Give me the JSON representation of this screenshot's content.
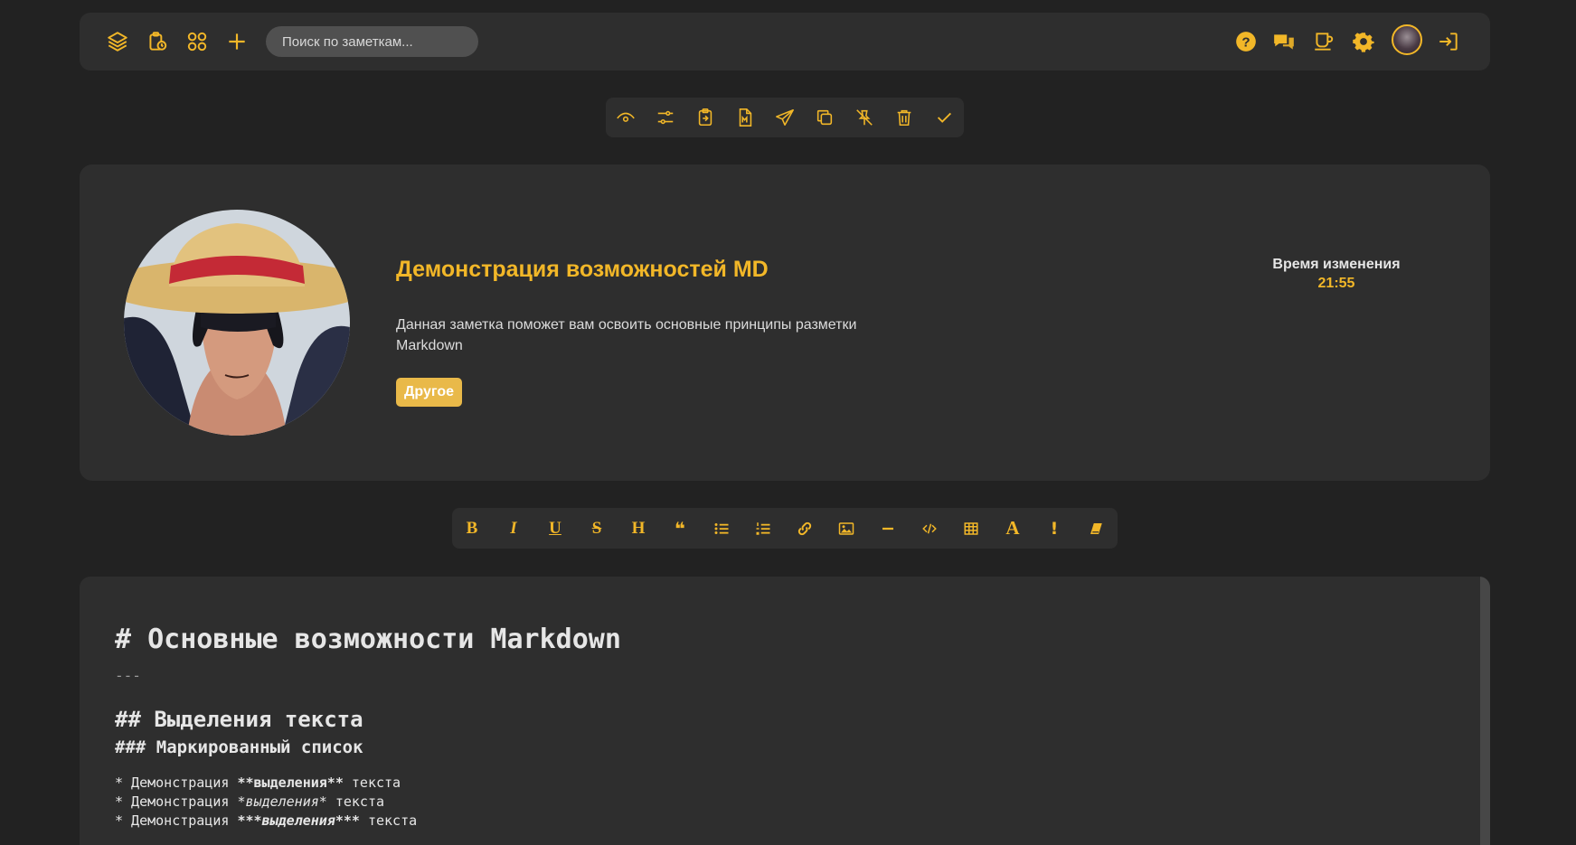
{
  "colors": {
    "accent": "#f2b728",
    "background": "#222222",
    "panel": "#2e2e2e",
    "tag": "#e9b949"
  },
  "topbar": {
    "left_icons": [
      "layers-icon",
      "clipboard-clock-icon",
      "grid-icon",
      "plus-icon"
    ],
    "search_placeholder": "Поиск по заметкам...",
    "right_icons": [
      "help-icon",
      "chat-icon",
      "coffee-icon",
      "gear-icon",
      "user-avatar",
      "logout-icon"
    ]
  },
  "note_toolbar": {
    "icons": [
      "eye-icon",
      "sliders-icon",
      "clipboard-export-icon",
      "markdown-file-icon",
      "send-icon",
      "copy-icon",
      "unpin-icon",
      "trash-icon",
      "check-icon"
    ]
  },
  "note": {
    "title": "Демонстрация возможностей MD",
    "description": "Данная заметка поможет вам освоить основные принципы разметки Markdown",
    "tag": "Другое",
    "time_label": "Время изменения",
    "time_value": "21:55"
  },
  "md_toolbar": {
    "bold": "B",
    "italic": "I",
    "underline": "U",
    "strike": "S",
    "heading": "H",
    "quote": "❝",
    "font": "A",
    "important": "!",
    "icons": [
      "quote-icon",
      "bullet-list-icon",
      "numbered-list-icon",
      "link-icon",
      "image-icon",
      "hr-icon",
      "code-icon",
      "table-icon",
      "font-icon",
      "exclamation-icon",
      "eraser-icon"
    ]
  },
  "editor": {
    "h1": "# Основные возможности Markdown",
    "hr": "---",
    "h2": "## Выделения текста",
    "h3": "### Маркированный список",
    "list": [
      {
        "prefix": "* Демонстрация ",
        "mark": "**выделения**",
        "suffix": " текста"
      },
      {
        "prefix": "* Демонстрация ",
        "mark": "*выделения*",
        "suffix": " текста"
      },
      {
        "prefix": "* Демонстрация ",
        "mark": "***выделения***",
        "suffix": " текста"
      }
    ]
  }
}
